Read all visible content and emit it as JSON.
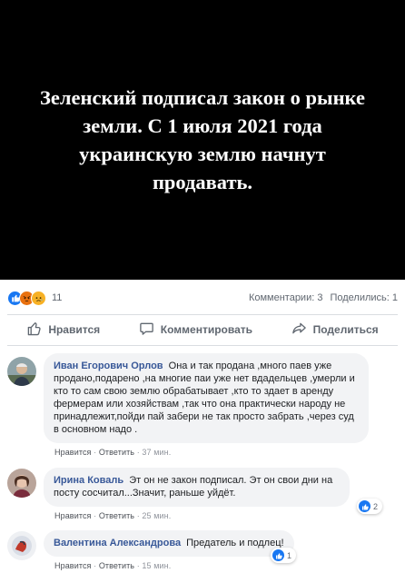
{
  "post_image": {
    "text": "Зеленский подписал закон о рынке земли. С 1 июля 2021 года украинскую землю начнут продавать."
  },
  "reactions": {
    "icons": [
      "like-icon",
      "angry-icon",
      "sad-icon"
    ],
    "count": "11",
    "comments_label": "Комментарии: 3",
    "shares_label": "Поделились: 1"
  },
  "actions": {
    "like": "Нравится",
    "comment": "Комментировать",
    "share": "Поделиться"
  },
  "comments": [
    {
      "author": "Иван Егорович Орлов",
      "text": "Она и так продана ,много паев уже продано,подарено ,на многие паи уже нет вдадельцев ,умерли и кто то сам свою землю обрабатывает ,кто то здает в аренду фермерам или хозяйствам ,так что она практически народу не принадлежит,пойди пай забери не так просто забрать ,через суд в основном надо .",
      "like_label": "Нравится",
      "reply_label": "Ответить",
      "time": "37 мин.",
      "reaction_count": ""
    },
    {
      "author": "Ирина Коваль",
      "text": "Эт он не закон подписал. Эт он свои дни на посту сосчитал...Значит, раньше уйдёт.",
      "like_label": "Нравится",
      "reply_label": "Ответить",
      "time": "25 мин.",
      "reaction_count": "2"
    },
    {
      "author": "Валентина Александрова",
      "text": "Предатель и подлец!",
      "like_label": "Нравится",
      "reply_label": "Ответить",
      "time": "15 мин.",
      "reaction_count": "1"
    }
  ],
  "colors": {
    "accent": "#385898",
    "like_blue": "#1877f2",
    "bubble_bg": "#f2f3f5"
  }
}
